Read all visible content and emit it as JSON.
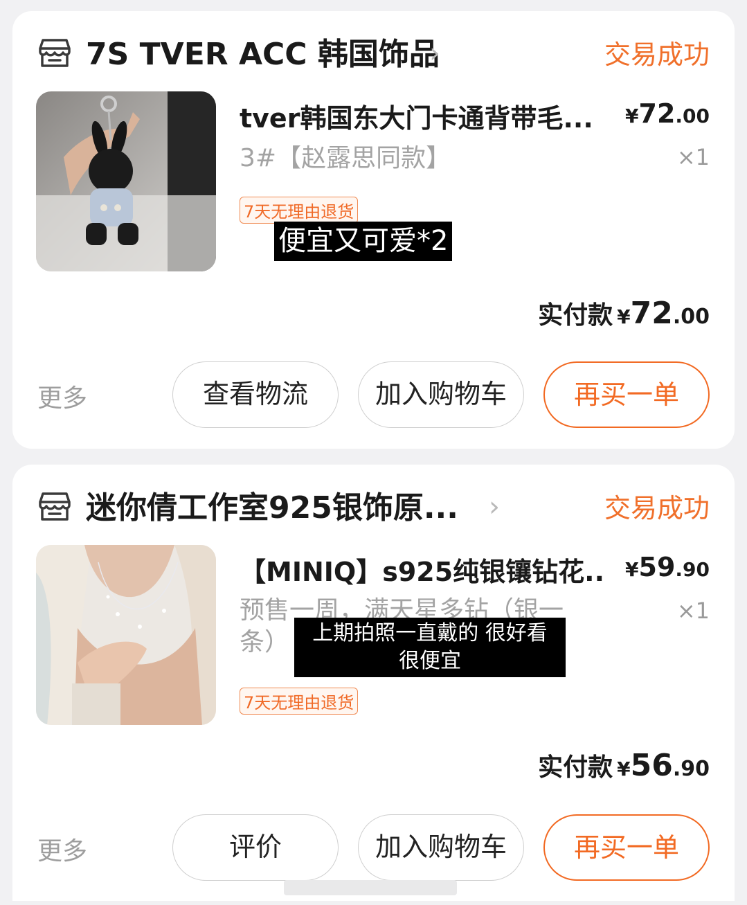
{
  "orders": [
    {
      "shop_name": "7S TVER ACC 韩国饰品",
      "status": "交易成功",
      "product_title": "tver韩国东大门卡通背带毛...",
      "variant": "3#【赵露思同款】",
      "price_yen": "¥",
      "price_int": "72",
      "price_dec": ".00",
      "quantity": "×1",
      "return_tag": "7天无理由退货",
      "caption": "便宜又可爱*2",
      "paid_label": "实付款",
      "paid_yen": "¥",
      "paid_int": "72",
      "paid_dec": ".00",
      "more": "更多",
      "buttons": [
        "查看物流",
        "加入购物车",
        "再买一单"
      ]
    },
    {
      "shop_name": "迷你倩工作室925银饰原...",
      "status": "交易成功",
      "product_title": "【MINIQ】s925纯银镶钻花...",
      "variant_line1": "预售一周，满天星多钻（银一",
      "variant_line2": "条）",
      "price_yen": "¥",
      "price_int": "59",
      "price_dec": ".90",
      "quantity": "×1",
      "return_tag": "7天无理由退货",
      "caption_line1": "上期拍照一直戴的 很好看",
      "caption_line2": "很便宜",
      "paid_label": "实付款",
      "paid_yen": "¥",
      "paid_int": "56",
      "paid_dec": ".90",
      "more": "更多",
      "buttons": [
        "评价",
        "加入购物车",
        "再买一单"
      ]
    }
  ],
  "icons": {
    "shop": "shop-icon",
    "chevron": "chevron-right-icon"
  },
  "colors": {
    "accent": "#f26a23",
    "status": "#f0702b",
    "muted_text": "#a3a3a3",
    "page_bg": "#f1f1f3"
  }
}
